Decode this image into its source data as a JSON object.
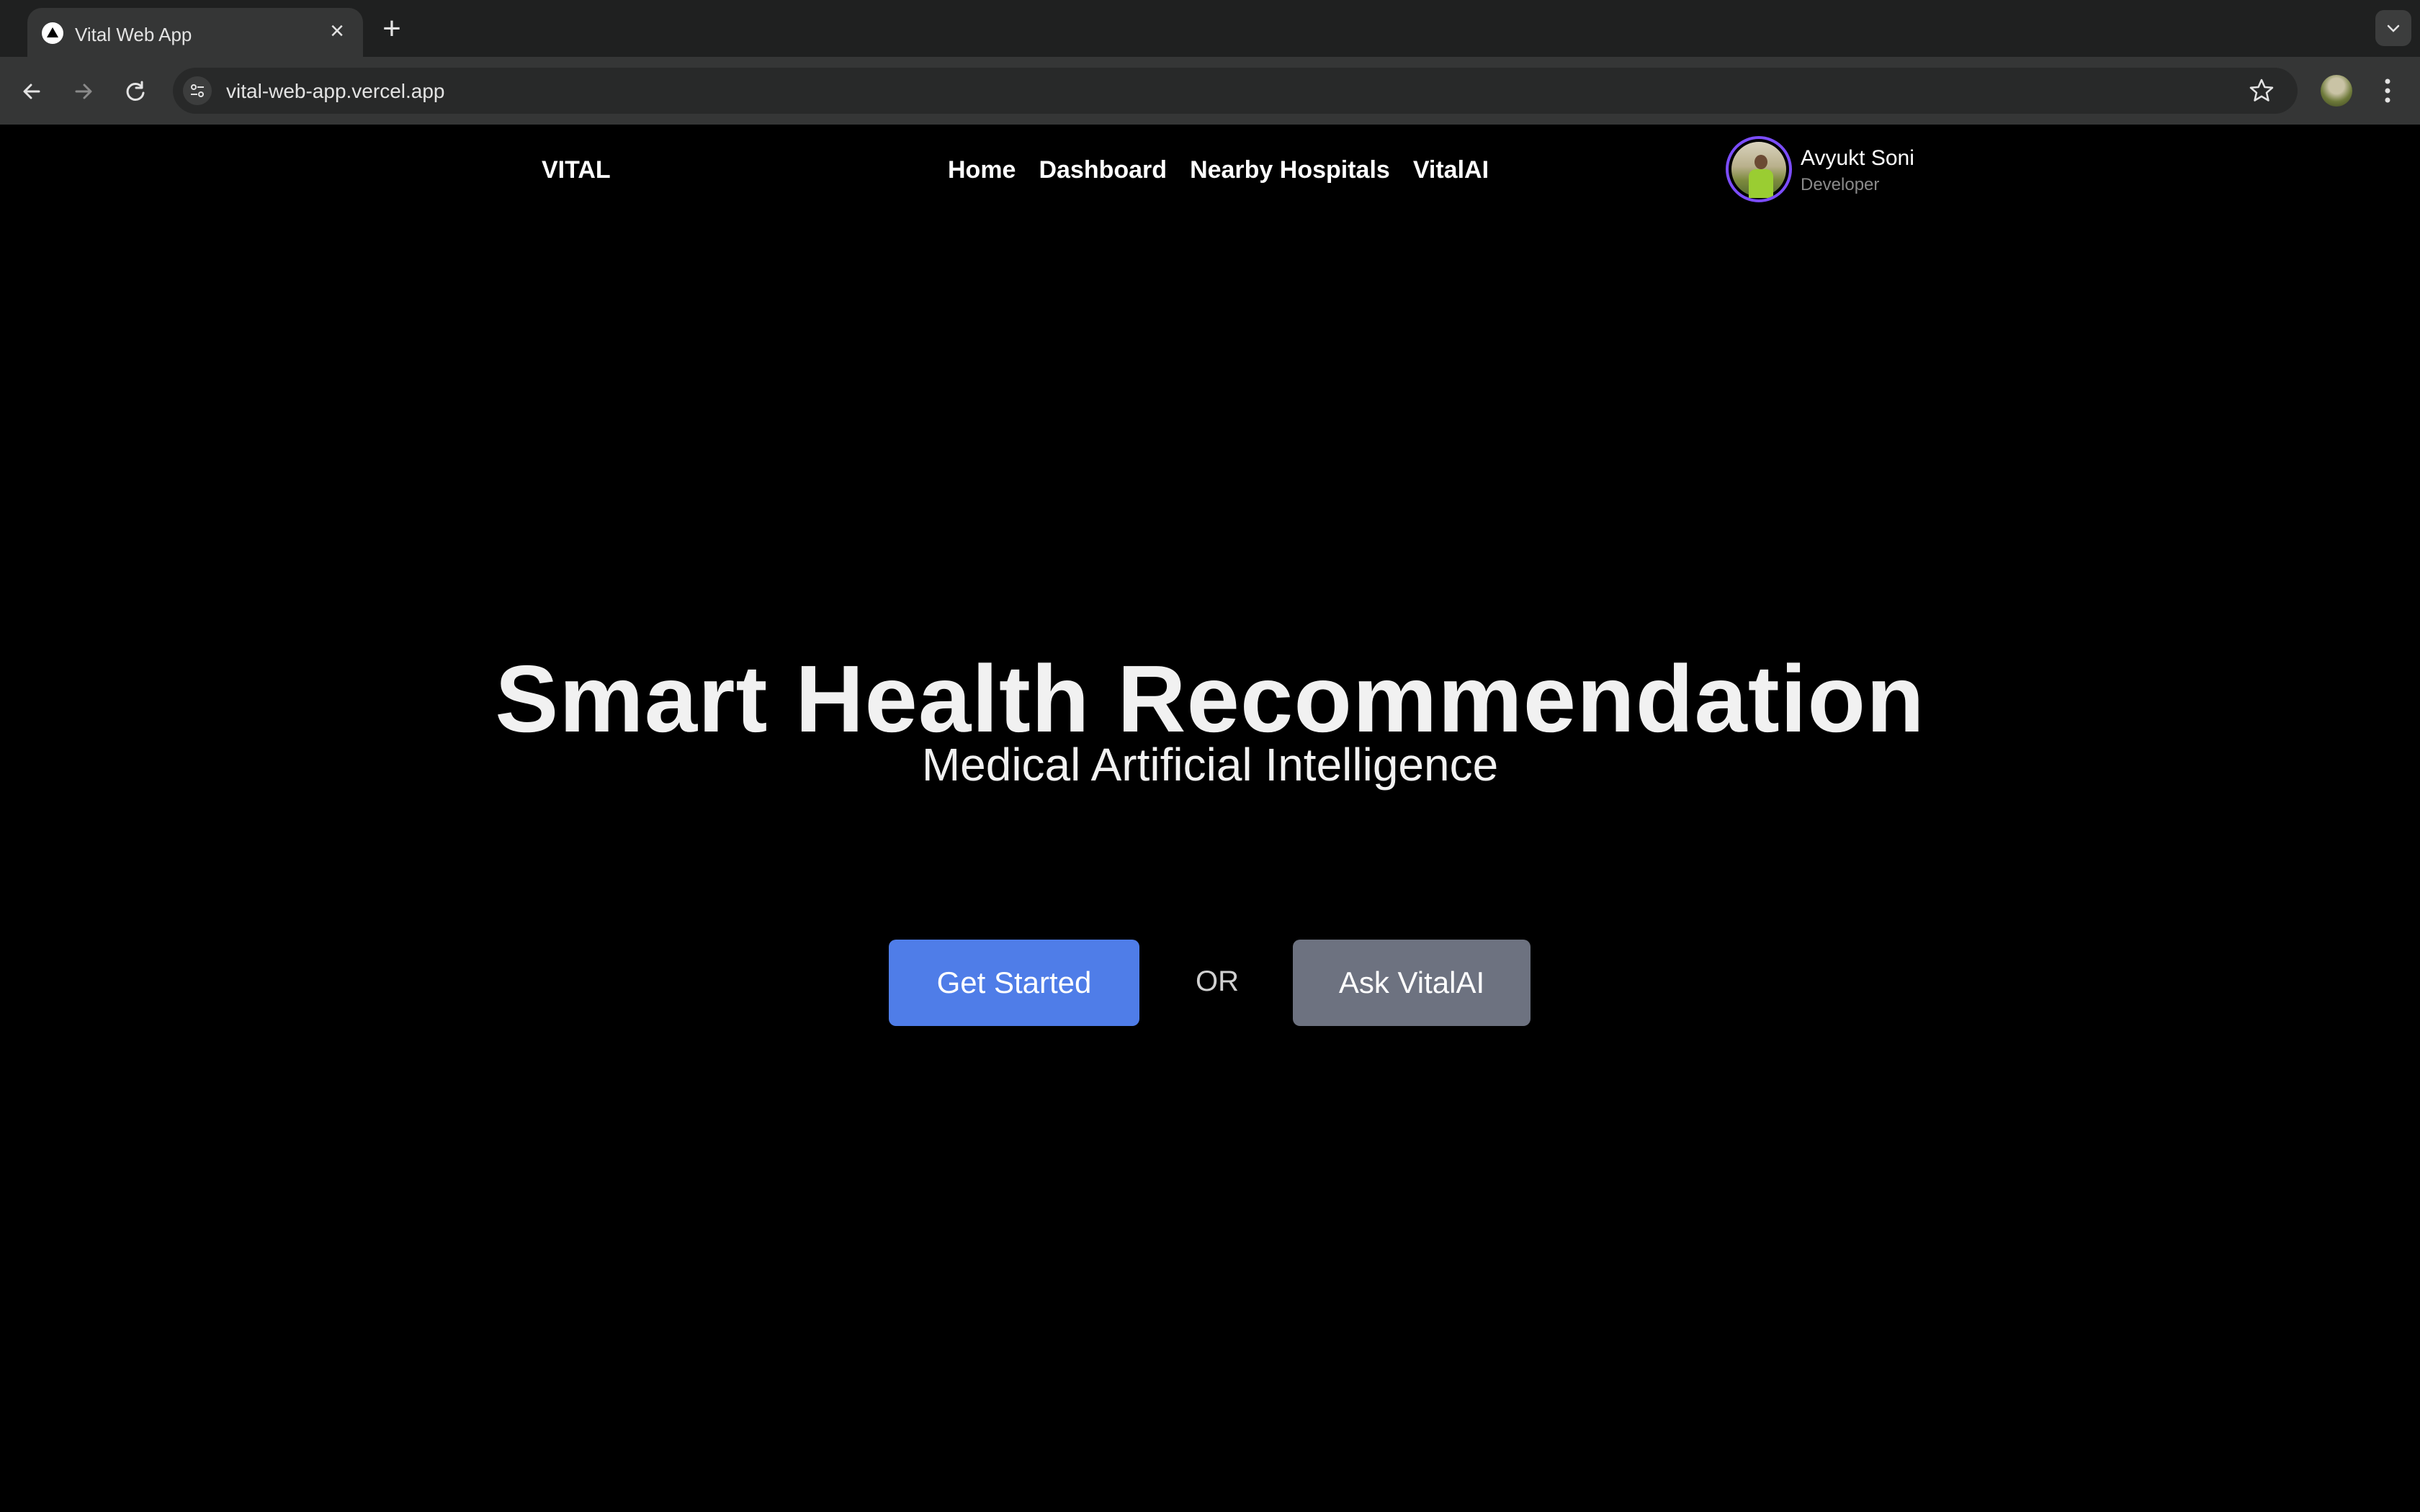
{
  "browser": {
    "tab_title": "Vital Web App",
    "url": "vital-web-app.vercel.app"
  },
  "navbar": {
    "brand": "VITAL",
    "links": [
      "Home",
      "Dashboard",
      "Nearby Hospitals",
      "VitalAI"
    ],
    "user": {
      "name": "Avyukt Soni",
      "role": "Developer"
    }
  },
  "hero": {
    "title": "Smart Health Recommendation",
    "subtitle": "Medical Artificial Intelligence",
    "primary_cta": "Get Started",
    "separator": "OR",
    "secondary_cta": "Ask VitalAI"
  },
  "colors": {
    "background": "#000000",
    "primary_button": "#4f7de8",
    "secondary_button": "#6d7280",
    "avatar_ring": "#7c4dff"
  }
}
